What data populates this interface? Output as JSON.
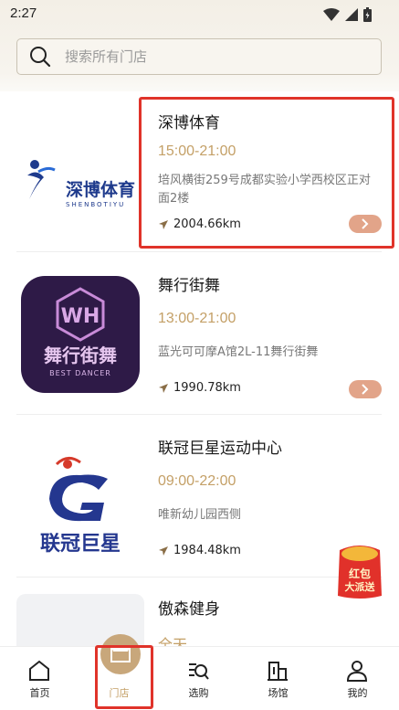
{
  "status_bar": {
    "time": "2:27"
  },
  "search": {
    "placeholder": "搜索所有门店"
  },
  "stores": [
    {
      "name": "深博体育",
      "hours": "15:00-21:00",
      "address": "培风横街259号成都实验小学西校区正对面2楼",
      "distance": "2004.66km",
      "logo_text": "深博体育",
      "logo_subtext": "SHENBOTIYU"
    },
    {
      "name": "舞行街舞",
      "hours": "13:00-21:00",
      "address": "蓝光可可摩A馆2L-11舞行街舞",
      "distance": "1990.78km",
      "logo_text": "舞行街舞",
      "logo_subtext": "BEST DANCER"
    },
    {
      "name": "联冠巨星运动中心",
      "hours": "09:00-22:00",
      "address": "唯新幼儿园西侧",
      "distance": "1984.48km",
      "logo_text": "联冠巨星"
    },
    {
      "name": "傲森健身",
      "hours": "全天"
    }
  ],
  "red_packet": {
    "line1": "红包",
    "line2": "大派送"
  },
  "tabbar": {
    "items": [
      {
        "label": "首页",
        "icon": "home-icon"
      },
      {
        "label": "门店",
        "icon": "store-icon"
      },
      {
        "label": "选购",
        "icon": "shopping-search-icon"
      },
      {
        "label": "场馆",
        "icon": "venue-icon"
      },
      {
        "label": "我的",
        "icon": "user-icon"
      }
    ],
    "active_index": 1
  },
  "colors": {
    "accent": "#c4a067",
    "go_button": "#e2a489",
    "highlight": "#e0332a"
  }
}
